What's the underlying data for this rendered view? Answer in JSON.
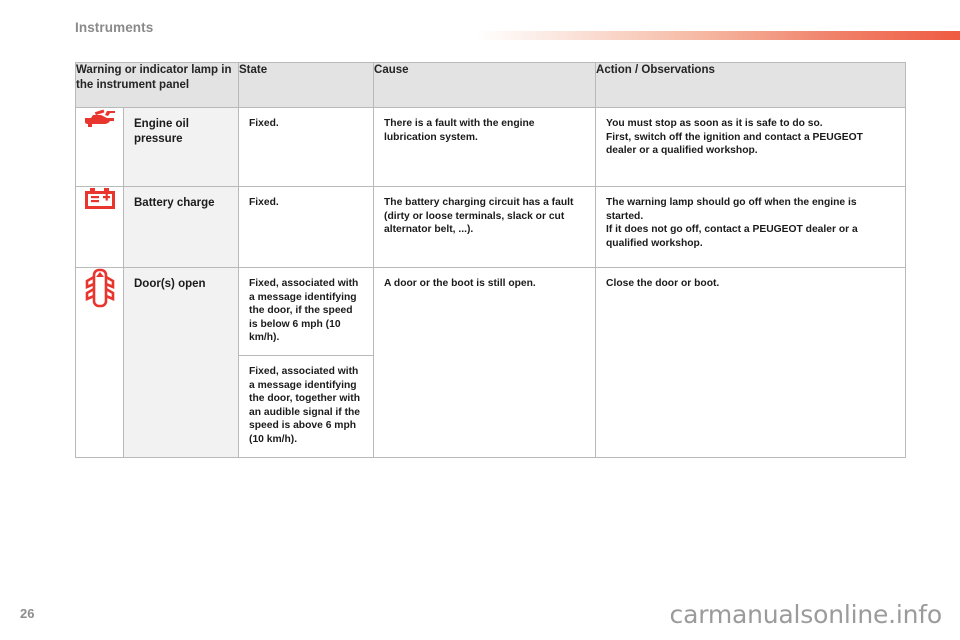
{
  "header": {
    "chapter_title": "Instruments",
    "rule_color_start": "#ffffff",
    "rule_color_end": "#ef5b42"
  },
  "table": {
    "columns": [
      {
        "key": "lamp",
        "label": "Warning or indicator lamp in the instrument panel"
      },
      {
        "key": "state",
        "label": "State"
      },
      {
        "key": "cause",
        "label": "Cause"
      },
      {
        "key": "action",
        "label": "Action / Observations"
      }
    ],
    "rows": [
      {
        "icon": "oil-can-icon",
        "icon_color": "#e8352e",
        "name": "Engine oil pressure",
        "states": [
          "Fixed."
        ],
        "cause": "There is a fault with the engine lubrication system.",
        "action_lines": [
          "You must stop as soon as it is safe to do so.",
          "First, switch off the ignition and contact a PEUGEOT dealer or a qualified workshop."
        ]
      },
      {
        "icon": "battery-icon",
        "icon_color": "#e8352e",
        "name": "Battery charge",
        "states": [
          "Fixed."
        ],
        "cause": "The battery charging circuit has a fault (dirty or loose terminals, slack or cut alternator belt, ...).",
        "action_lines": [
          "The warning lamp should go off when the engine is started.",
          "If it does not go off, contact a PEUGEOT dealer or a qualified workshop."
        ]
      },
      {
        "icon": "doors-open-icon",
        "icon_color": "#e8352e",
        "name": "Door(s) open",
        "states": [
          "Fixed, associated with a message identifying the door, if the speed is below 6 mph (10 km/h).",
          "Fixed, associated with a message identifying the door, together with an audible signal if the speed is above 6 mph (10 km/h)."
        ],
        "cause": "A door or the boot is still open.",
        "action_lines": [
          "Close the door or boot."
        ]
      }
    ]
  },
  "footer": {
    "page_number": "26",
    "watermark": "carmanualsonline.info"
  }
}
